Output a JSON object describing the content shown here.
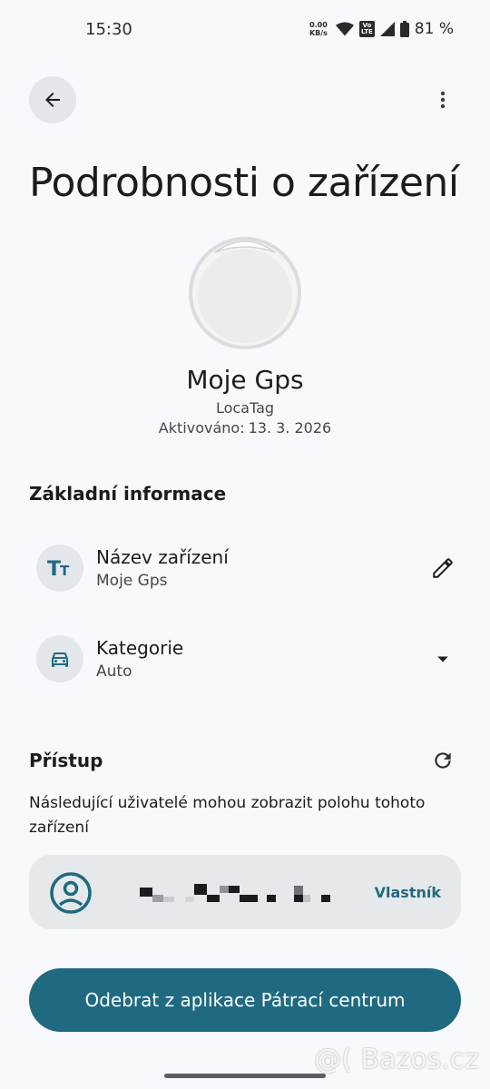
{
  "status_bar": {
    "time": "15:30",
    "network_speed": "0.00",
    "network_unit": "KB/s",
    "volte_top": "Vo",
    "volte_bottom": "LTE",
    "battery": "81 %"
  },
  "header": {
    "title": "Podrobnosti o zařízení"
  },
  "device": {
    "name": "Moje Gps",
    "brand": "LocaTag",
    "activated_label": "Aktivováno:",
    "activated_date": "13. 3. 2026"
  },
  "basic_info": {
    "heading": "Základní informace",
    "items": [
      {
        "title": "Název zařízení",
        "value": "Moje Gps",
        "icon": "text-format-icon",
        "action_icon": "pencil-icon"
      },
      {
        "title": "Kategorie",
        "value": "Auto",
        "icon": "car-icon",
        "action_icon": "dropdown-arrow-icon"
      }
    ]
  },
  "access": {
    "heading": "Přístup",
    "description": "Následující uživatelé mohou zobrazit polohu tohoto zařízení",
    "users": [
      {
        "role": "Vlastník"
      }
    ]
  },
  "actions": {
    "remove_label": "Odebrat z aplikace Pátrací centrum"
  },
  "watermark": "@( Bazos.cz",
  "colors": {
    "accent": "#1f6a80",
    "background": "#f7f9fc",
    "surface": "#e3e6ea"
  }
}
